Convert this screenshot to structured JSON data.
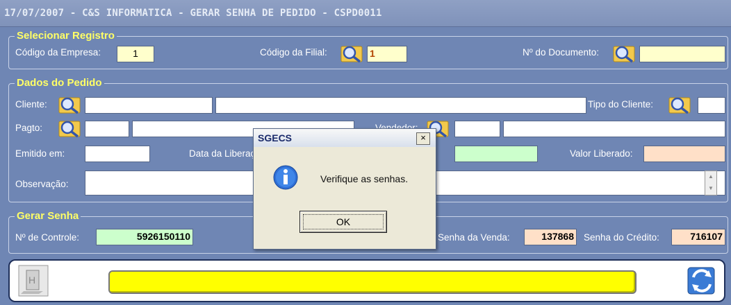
{
  "window": {
    "title": "17/07/2007 - C&S INFORMATICA - GERAR SENHA DE PEDIDO - CSPD0011"
  },
  "selecionar": {
    "legend": "Selecionar Registro",
    "empresa_label": "Código da Empresa:",
    "empresa_value": "1",
    "filial_label": "Código da Filial:",
    "filial_value": "1",
    "documento_label": "Nº do Documento:",
    "documento_value": ""
  },
  "dados": {
    "legend": "Dados do Pedido",
    "cliente_label": "Cliente:",
    "tipo_cliente_label": "Tipo do Cliente:",
    "pagto_label": "Pagto:",
    "vendedor_label": "Vendedor:",
    "emitido_label": "Emitido em:",
    "data_lib_label": "Data da Liberação:",
    "valor_liberado_label": "Valor Liberado:",
    "observacao_label": "Observação:"
  },
  "gerar": {
    "legend": "Gerar Senha",
    "controle_label": "Nº de Controle:",
    "controle_value": "5926150110",
    "senha_venda_label": "Senha da Venda:",
    "senha_venda_value": "137868",
    "senha_credito_label": "Senha do Crédito:",
    "senha_credito_value": "716107"
  },
  "dialog": {
    "title": "SGECS",
    "close": "×",
    "message": "Verifique as senhas.",
    "ok_label": "OK"
  },
  "icons": [
    "lookup-magnifier-icon",
    "info-icon",
    "exit-door-icon",
    "generate-refresh-icon"
  ],
  "colors": {
    "background": "#6f86b4",
    "legend": "#ffff66",
    "status_bar": "#ffff00",
    "green_field": "#ccffcc",
    "peach_field": "#ffe0c8"
  }
}
